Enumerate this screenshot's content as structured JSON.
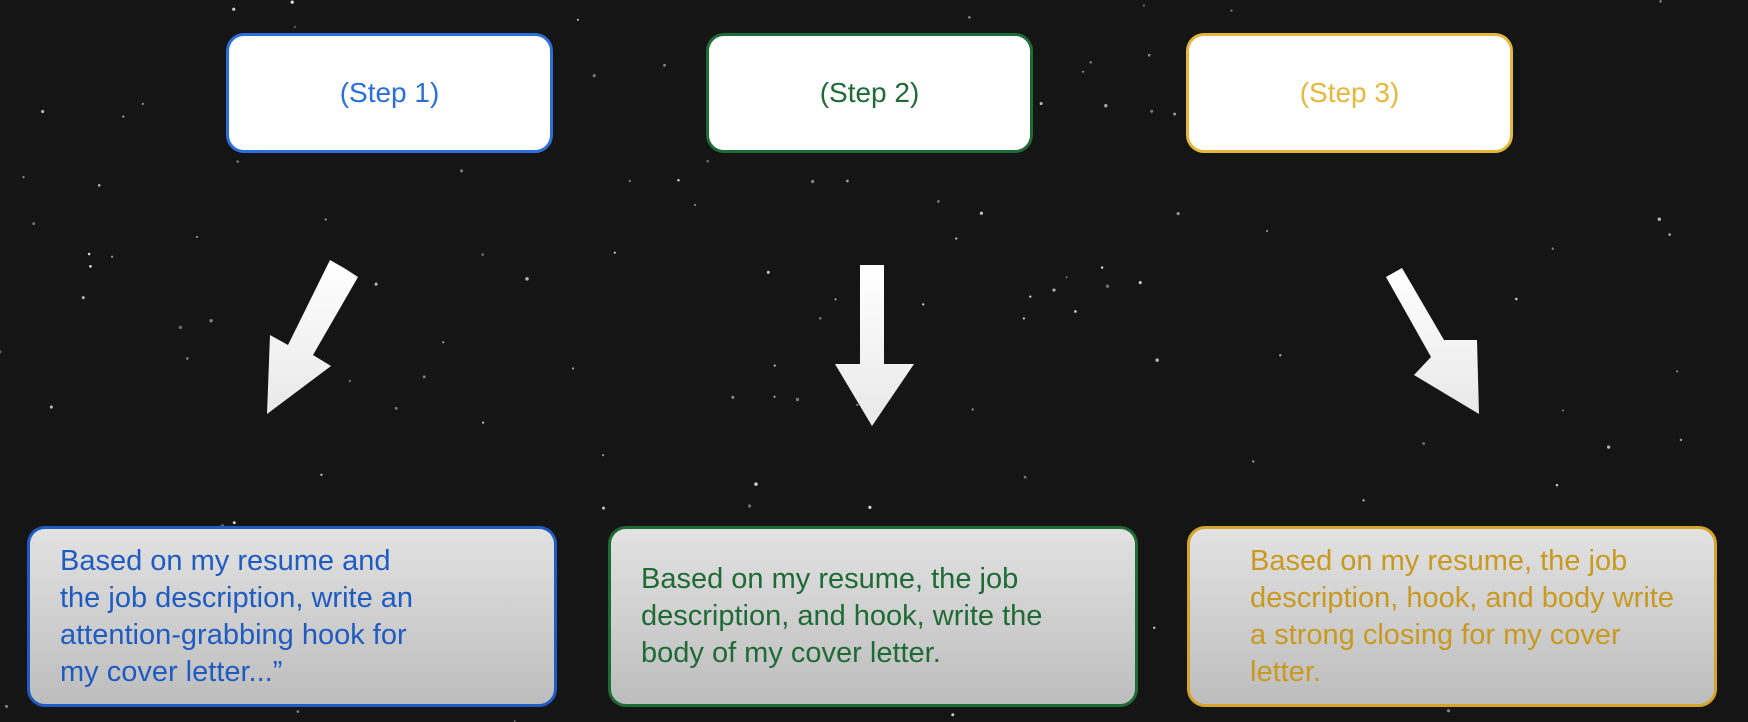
{
  "colors": {
    "step1": "#2a6fdb",
    "step2": "#1e6b35",
    "step3": "#e6b83a",
    "prompt1": "#1f5cc2",
    "prompt2": "#1e6b35",
    "prompt3": "#c99a20"
  },
  "steps": [
    {
      "label": "(Step 1)"
    },
    {
      "label": "(Step 2)"
    },
    {
      "label": "(Step 3)"
    }
  ],
  "prompts": [
    {
      "text": "Based on my resume and the job description, write an attention-grabbing hook for my cover letter...”"
    },
    {
      "text": "Based on my resume, the job description, and hook, write the body of my cover letter."
    },
    {
      "text": "Based on my resume, the job description, hook, and body write a strong closing for my cover letter."
    }
  ]
}
